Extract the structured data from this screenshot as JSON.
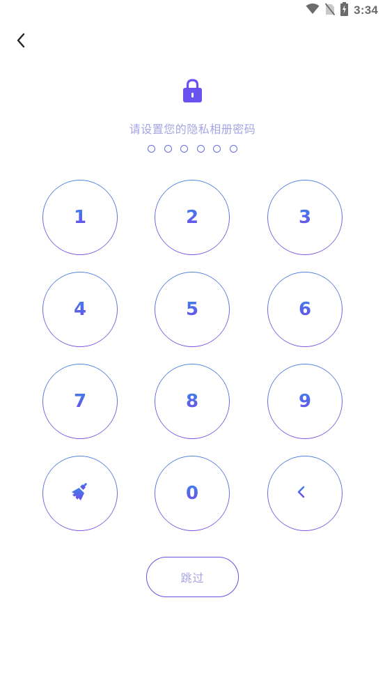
{
  "status_bar": {
    "time": "3:34",
    "icons": [
      "wifi-icon",
      "no-sim-icon",
      "battery-charging-icon"
    ]
  },
  "header": {
    "back_icon": "chevron-left-icon"
  },
  "lock": {
    "icon": "lock-icon",
    "color": "#6a52f0"
  },
  "prompt": {
    "text": "请设置您的隐私相册密码"
  },
  "pin": {
    "length": 6,
    "entered": 0
  },
  "keypad": {
    "keys": [
      {
        "label": "1"
      },
      {
        "label": "2"
      },
      {
        "label": "3"
      },
      {
        "label": "4"
      },
      {
        "label": "5"
      },
      {
        "label": "6"
      },
      {
        "label": "7"
      },
      {
        "label": "8"
      },
      {
        "label": "9"
      },
      {
        "label": "",
        "icon": "broom-clear-icon"
      },
      {
        "label": "0"
      },
      {
        "label": "",
        "icon": "backspace-arrow-icon"
      }
    ]
  },
  "skip": {
    "label": "跳过"
  },
  "colors": {
    "accent_blue": "#4c82dc",
    "accent_purple": "#7a4fe0",
    "prompt_text": "#a7a4e3"
  }
}
